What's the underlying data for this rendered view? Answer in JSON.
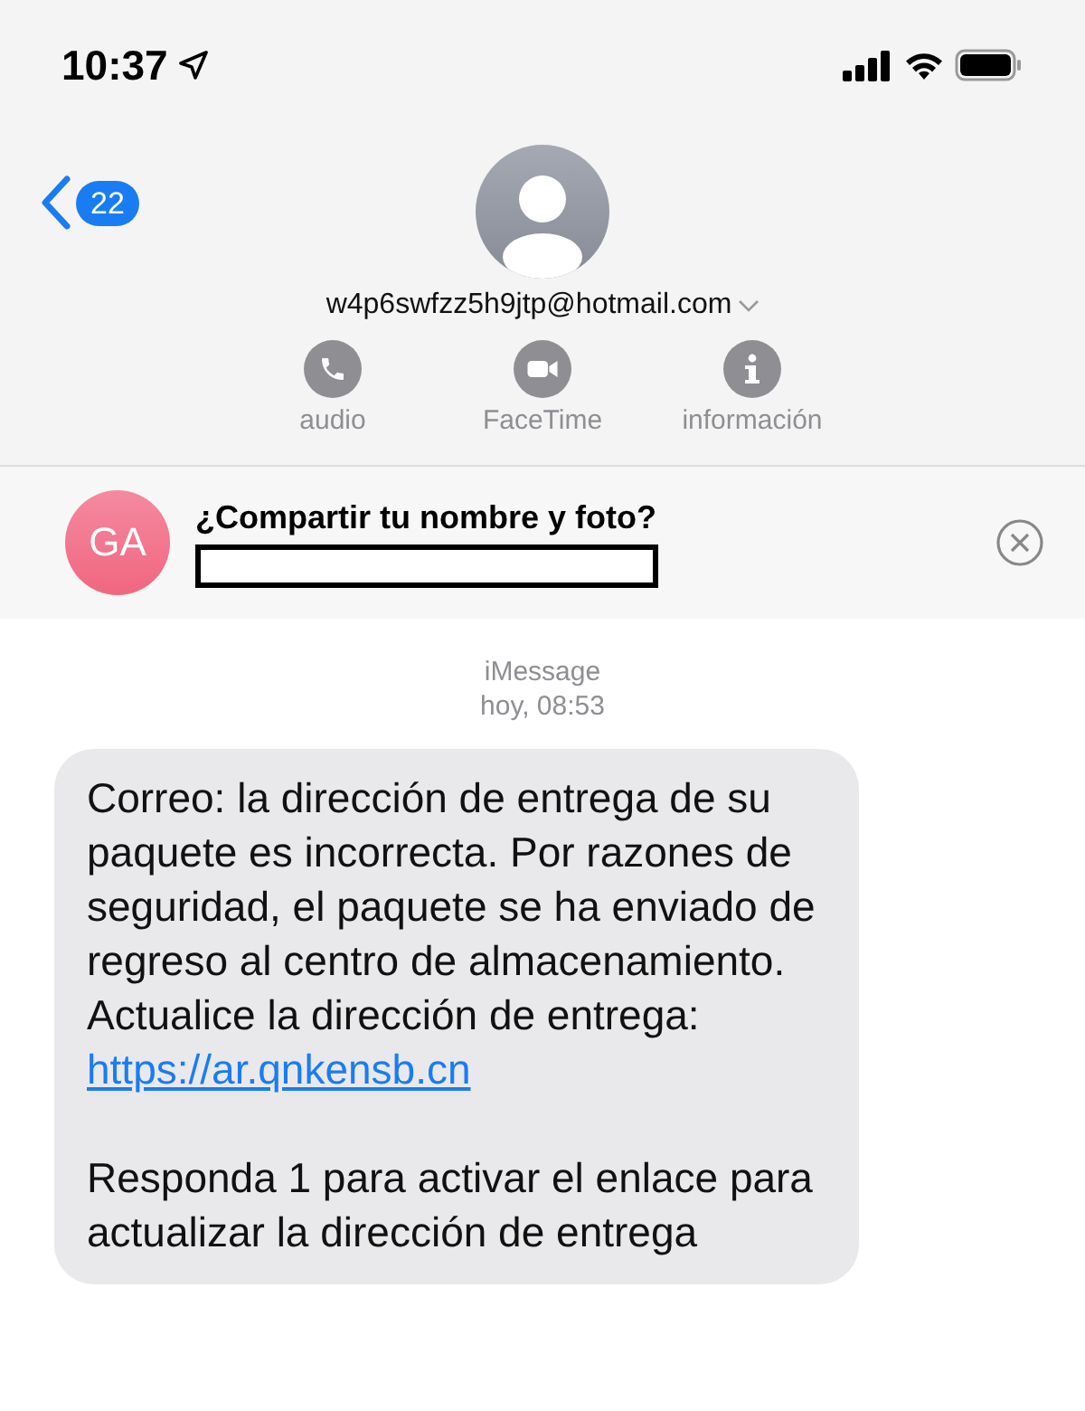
{
  "status_bar": {
    "time": "10:37"
  },
  "nav": {
    "back_count": "22"
  },
  "contact": {
    "address": "w4p6swfzz5h9jtp@hotmail.com"
  },
  "actions": [
    {
      "kind": "audio",
      "label": "audio"
    },
    {
      "kind": "video",
      "label": "FaceTime"
    },
    {
      "kind": "info",
      "label": "información"
    }
  ],
  "share_banner": {
    "initials": "GA",
    "title": "¿Compartir tu nombre y foto?"
  },
  "thread_header": {
    "service": "iMessage",
    "timestamp": "hoy, 08:53"
  },
  "message": {
    "paragraphs": [
      {
        "kind": "text_with_link",
        "text": "Correo: la dirección de entrega de su paquete es incorrecta. Por razones de seguridad, el paquete se ha enviado de regreso al centro de almacenamiento. Actualice la dirección de entrega:",
        "link": "https://ar.qnkensb.cn"
      },
      {
        "kind": "text",
        "text": "Responda 1 para activar el enlace para actualizar la dirección de entrega"
      }
    ]
  }
}
